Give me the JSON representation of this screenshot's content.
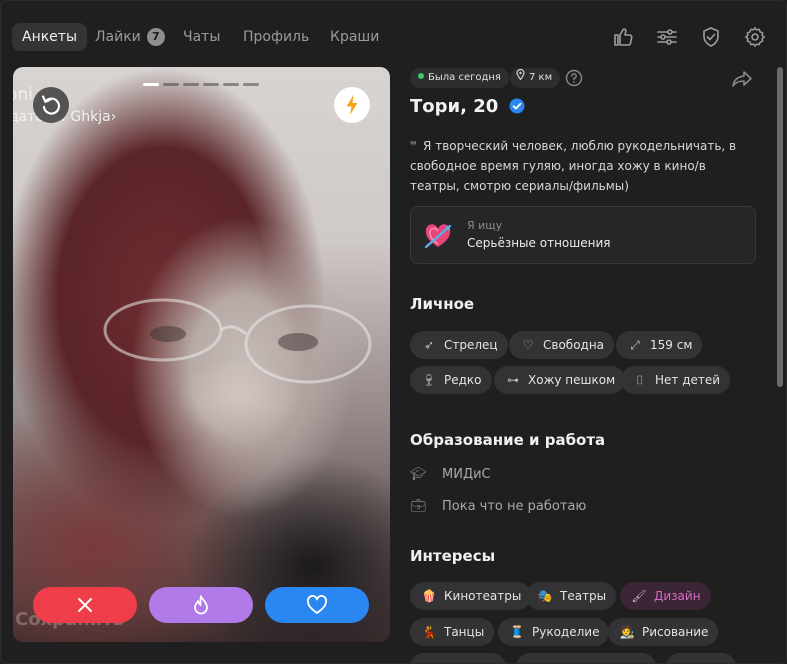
{
  "nav": {
    "tabs": [
      {
        "label": "Анкеты"
      },
      {
        "label": "Лайки",
        "badge": "7"
      },
      {
        "label": "Чаты"
      },
      {
        "label": "Профиль"
      },
      {
        "label": "Краши"
      }
    ],
    "icons": [
      "thumbs-up-icon",
      "sliders-icon",
      "shield-check-icon",
      "gear-icon"
    ]
  },
  "photo": {
    "overlay_top": "oni",
    "overlay_sub": "датель: Ghkja›",
    "save_text": "Сохранить",
    "progress_total": 6,
    "progress_current": 1
  },
  "actions": {
    "dislike_color": "#ef3e4a",
    "superlike_color": "#b07ae8",
    "like_color": "#2a86f0"
  },
  "profile": {
    "status": "Была сегодня",
    "distance": "7 км",
    "name": "Тори, 20",
    "about": "Я творческий человек, люблю рукодельничать, в свободное время гуляю, иногда хожу в кино/в театры, смотрю сериалы/фильмы)",
    "seeking_label": "Я ищу",
    "seeking_value": "Серьёзные отношения"
  },
  "personal": {
    "title": "Личное",
    "chips": [
      {
        "label": "Стрелец",
        "icon": "sagittarius-icon"
      },
      {
        "label": "Свободна",
        "icon": "heart-outline-icon"
      },
      {
        "label": "159 см",
        "icon": "height-icon"
      },
      {
        "label": "Редко",
        "icon": "wine-glass-icon"
      },
      {
        "label": "Хожу пешком",
        "icon": "dumbbell-icon"
      },
      {
        "label": "Нет детей",
        "icon": "baby-bottle-icon"
      }
    ]
  },
  "education": {
    "title": "Образование и работа",
    "school": "МИДиС",
    "work": "Пока что не работаю"
  },
  "interests": {
    "title": "Интересы",
    "chips": [
      {
        "label": "Кинотеатры",
        "icon": "popcorn-icon"
      },
      {
        "label": "Театры",
        "icon": "theater-masks-icon"
      },
      {
        "label": "Дизайн",
        "icon": "brush-icon",
        "highlight": true
      },
      {
        "label": "Танцы",
        "icon": "dance-icon"
      },
      {
        "label": "Рукоделие",
        "icon": "thread-icon"
      },
      {
        "label": "Рисование",
        "icon": "artist-icon"
      }
    ]
  }
}
